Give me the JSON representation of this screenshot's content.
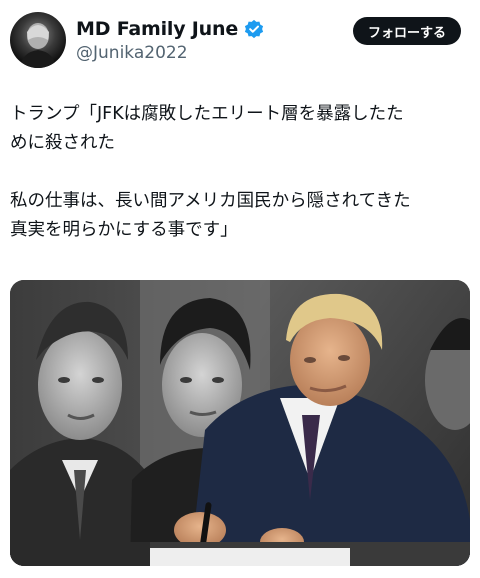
{
  "user": {
    "display_name": "MD Family June",
    "handle": "@Junika2022",
    "verified_icon": "verified-badge-icon"
  },
  "follow_button": {
    "label": "フォローする"
  },
  "tweet": {
    "lines": [
      "トランプ「JFKは腐敗したエリート層を暴露したた",
      "めに殺された",
      "",
      "私の仕事は、長い間アメリカ国民から隠されてきた",
      "真実を明らかにする事です」"
    ]
  },
  "media": {
    "description_icon": "photo-collage-image"
  },
  "colors": {
    "text": "#0f1419",
    "secondary": "#536471",
    "verified": "#1d9bf0",
    "button_bg": "#0f1419"
  }
}
